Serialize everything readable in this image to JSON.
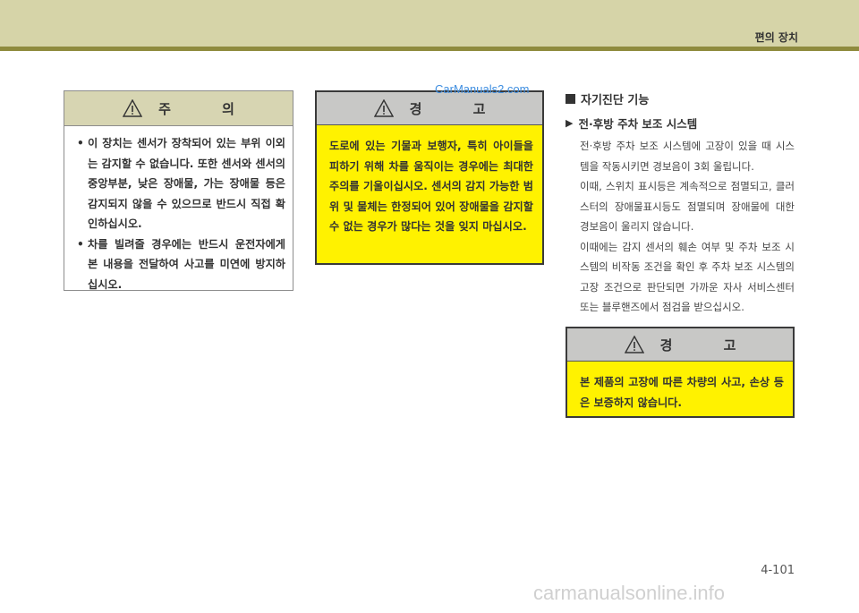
{
  "header": {
    "title": "편의 장치"
  },
  "caution": {
    "title": "주 의",
    "items": [
      "이 장치는 센서가 장착되어 있는 부위 이외는 감지할 수 없습니다. 또한 센서와 센서의 중앙부분, 낮은 장애물, 가는 장애물 등은 감지되지 않을 수 있으므로 반드시 직접 확인하십시오.",
      "차를 빌려줄 경우에는 반드시 운전자에게 본 내용을 전달하여 사고를 미연에 방지하십시오."
    ]
  },
  "warning1": {
    "title": "경 고",
    "text": "도로에 있는 기물과 보행자, 특히 아이들을 피하기 위해 차를 움직이는 경우에는 최대한 주의를 기울이십시오. 센서의 감지 가능한 범위 및 물체는 한정되어 있어 장애물을 감지할 수 없는 경우가 많다는 것을 잊지 마십시오."
  },
  "watermark_top": "CarManuals2.com",
  "section": {
    "title": "자기진단 기능"
  },
  "subsection": {
    "title": "전·후방 주차 보조 시스템"
  },
  "body": {
    "paragraphs": [
      "전·후방 주차 보조 시스템에 고장이 있을 때 시스템을 작동시키면 경보음이 3회 울립니다.",
      "이때, 스위치 표시등은 계속적으로 점멸되고, 클러스터의 장애물표시등도 점멸되며 장애물에 대한 경보음이 울리지 않습니다.",
      "이때에는 감지 센서의 훼손 여부 및 주차 보조 시스템의 비작동 조건을 확인 후 주차 보조 시스템의 고장 조건으로 판단되면 가까운 자사 서비스센터 또는 블루핸즈에서 점검을 받으십시오."
    ]
  },
  "warning2": {
    "title": "경 고",
    "text": "본 제품의 고장에 따른 차량의 사고, 손상 등은 보증하지 않습니다."
  },
  "page_number": "4-101",
  "footer_watermark": "carmanualsonline.info",
  "colors": {
    "header_bg": "#d6d4a8",
    "header_line": "#8f8b3e",
    "warning_bg": "#fff200",
    "caution_head_bg": "#d7d5b2"
  }
}
